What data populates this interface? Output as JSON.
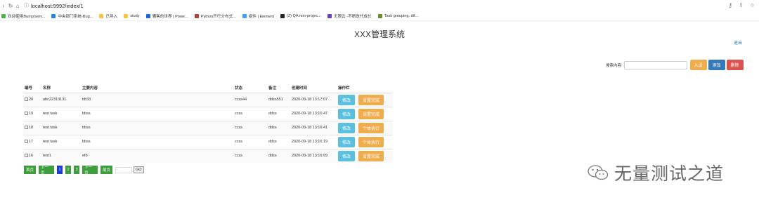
{
  "browser": {
    "url": "localhost:9992/index/1",
    "bookmarks": [
      {
        "label": "欢迎使用Bump/serv...",
        "color": "#4caf50"
      },
      {
        "label": "中央部门系统-Bug...",
        "color": "#1e88e5"
      },
      {
        "label": "已导入",
        "color": "#f4c542"
      },
      {
        "label": "study",
        "color": "#f4c542"
      },
      {
        "label": "骚客的世界 | Powe...",
        "color": "#1e63d8"
      },
      {
        "label": "Python开行分布式...",
        "color": "#b0413e"
      },
      {
        "label": "组件 | Element",
        "color": "#409eff"
      },
      {
        "label": "(2) QA non-projec...",
        "color": "#222222"
      },
      {
        "label": "无限云 -不断迭代成长",
        "color": "#6a3fb5"
      },
      {
        "label": "Task grouping, dif...",
        "color": "#6a8f2a"
      }
    ]
  },
  "header": {
    "title": "XXX管理系统",
    "logout_label": "退出"
  },
  "search": {
    "label": "搜索内容:",
    "value": "",
    "add_label": "入设",
    "search_label": "添加",
    "delete_label": "删除"
  },
  "table": {
    "columns": [
      "编号",
      "名称",
      "主要内容",
      "状态",
      "备注",
      "创建时间",
      "操作栏"
    ],
    "rows": [
      {
        "id": "20",
        "name": "abc22313131",
        "content": "bb33",
        "status": "ccss44",
        "remark": "ddss551",
        "created": "2020-09-18 13:17:07",
        "edit_label": "修改",
        "action_label": "设置完成"
      },
      {
        "id": "19",
        "name": "test task",
        "content": "bbss",
        "status": "ccss",
        "remark": "ddss",
        "created": "2020-09-18 13:16:47",
        "edit_label": "修改",
        "action_label": "设置完成"
      },
      {
        "id": "18",
        "name": "test task",
        "content": "bbss",
        "status": "ccss",
        "remark": "ddss",
        "created": "2020-09-18 13:16:41",
        "edit_label": "修改",
        "action_label": "个体执行"
      },
      {
        "id": "17",
        "name": "test task",
        "content": "bbss",
        "status": "ccss",
        "remark": "ddss",
        "created": "2020-09-18 13:16:19",
        "edit_label": "修改",
        "action_label": "个体执行"
      },
      {
        "id": "16",
        "name": "test1",
        "content": "efb",
        "status": "ccss",
        "remark": "ddss",
        "created": "2020-09-18 13:16:09",
        "edit_label": "修改",
        "action_label": "设置完成"
      }
    ]
  },
  "pager": {
    "first_label": "首页",
    "prev_label": "上一页",
    "pages": [
      "1",
      "2",
      "3"
    ],
    "current_page": "1",
    "next_label": "下一页",
    "last_label": "尾页",
    "go_label": "GO"
  },
  "watermark": {
    "text": "无量测试之道"
  },
  "colors": {
    "warning": "#f0ad4e",
    "primary": "#337ab7",
    "danger": "#d9534f",
    "info": "#5bc0de",
    "pager_green": "#3c9f3c",
    "pager_current": "#1a3cd8"
  }
}
